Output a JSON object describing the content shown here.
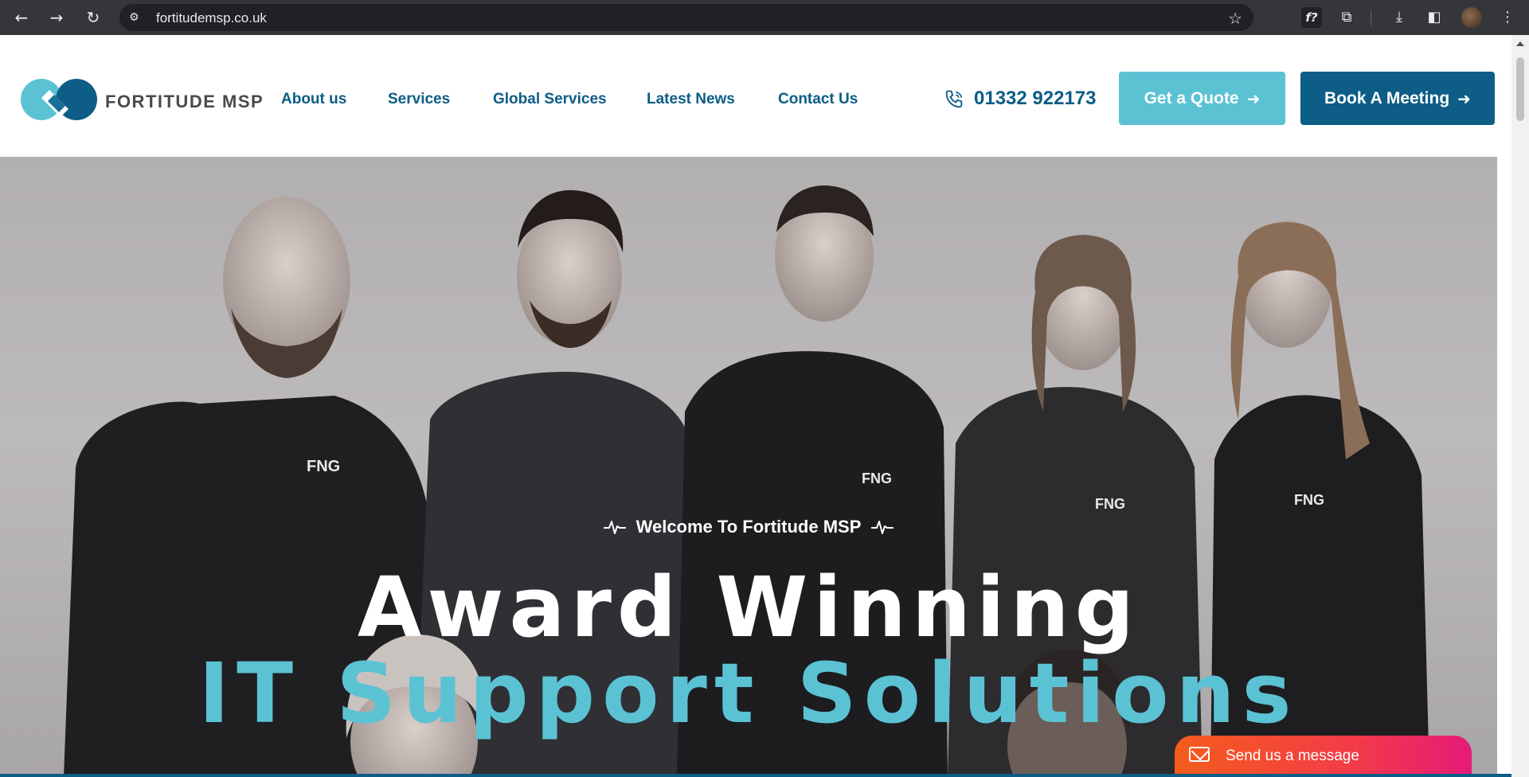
{
  "browser": {
    "url": "fortitudemsp.co.uk",
    "back_icon": "back-arrow-icon",
    "forward_icon": "forward-arrow-icon",
    "reload_icon": "reload-icon"
  },
  "site": {
    "logo_text": "FORTITUDE MSP",
    "nav": [
      "About us",
      "Services",
      "Global Services",
      "Latest News",
      "Contact Us"
    ],
    "phone": "01332 922173",
    "quote_button": "Get a Quote",
    "meeting_button": "Book A Meeting",
    "brand_colors": {
      "primary": "#0d5d86",
      "accent": "#5bc2d4"
    }
  },
  "hero": {
    "tagline": "Welcome To Fortitude MSP",
    "heading_line1": "Award Winning",
    "heading_line2": "IT Support Solutions",
    "shirt_logo": "FNG"
  },
  "chat_widget": {
    "label": "Send us a message"
  }
}
